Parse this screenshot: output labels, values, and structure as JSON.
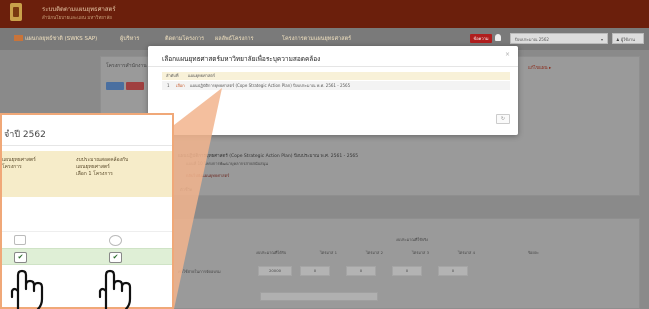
{
  "brand": {
    "title": "ระบบติดตามแผนยุทธศาสตร์",
    "subtitle": "สำนักนโยบายและแผน มหาวิทยาลัย"
  },
  "nav": {
    "plan": "แผนกลยุทธ์ชาติ (SWKS SAP)",
    "budget": "ผู้บริหาร",
    "project": "ติดตามโครงการ",
    "assess": "ผลลัพธ์โครงการ",
    "link": "โครงการตามแผนยุทธศาสตร์",
    "badge": "ข้อความ",
    "year_select": "ปีงบประมาณ 2562",
    "user": "ผู้ใช้งาน"
  },
  "background": {
    "panel_title": "โครงการสำนักงาน",
    "red_link": "แก้ไขแผน ▸",
    "plan_line": "แผนปฏิบัติการยุทธศาสตร์ (Cope Strategic Action Plan) ปีงบประมาณ พ.ศ. 2561 - 2565",
    "plan_line2": "แผนที่ 10 โครงการพัฒนาบุคลากรสายสนับสนุน",
    "plan_line3": "กลับไปยังแผนยุทธศาสตร์",
    "plan_line4": "ตัวชี้วัด",
    "table_group": "งบประมาณที่ใช้จริง",
    "table_headers": [
      "งบประมาณที่ได้รับ",
      "ไตรมาส 1",
      "ไตรมาส 2",
      "ไตรมาส 3",
      "ไตรมาส 4",
      "ร้อยละ"
    ],
    "row_label": "ค่าใช้จ่ายในการจัดอบรม",
    "row_values": [
      "20000",
      "0",
      "0",
      "0",
      "0"
    ]
  },
  "modal": {
    "title": "เลือกแผนยุทธศาสตร์มหาวิทยาลัยเพื่อระบุความสอดคล้อง",
    "close": "×",
    "col_no": "ลำดับที่",
    "col_plan": "แผนยุทธศาสตร์",
    "row_no": "1",
    "row_select": "เลือก",
    "row_plan": "แผนปฏิบัติการยุทธศาสตร์ (Cope Strategic Action Plan) ปีงบประมาณ พ.ศ. 2561 - 2565",
    "button": "↻"
  },
  "zoom": {
    "title": "จำปี 2562",
    "col1_line1": "แผนยุทธศาสตร์",
    "col1_line2": "โครงการ",
    "col2_line1": "งบประมาณสอดคล้องกับ",
    "col2_line2": "แผนยุทธศาสตร์",
    "col2_line3": "เลือก 1 โครงการ",
    "check": "✔"
  }
}
